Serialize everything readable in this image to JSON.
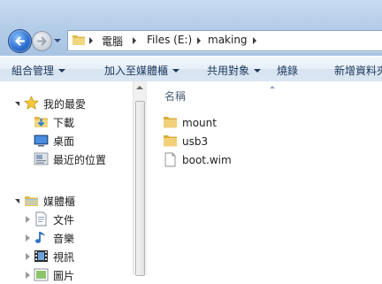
{
  "address": {
    "crumbs": [
      "電腦",
      "Files (E:)",
      "making"
    ]
  },
  "toolbar": {
    "organize": "組合管理",
    "add_to_library": "加入至媒體櫃",
    "share_with": "共用對象",
    "burn": "燒錄",
    "new_folder": "新增資料夾"
  },
  "nav": {
    "favorites": "我的最愛",
    "downloads": "下載",
    "desktop": "桌面",
    "recent_places": "最近的位置",
    "libraries": "媒體櫃",
    "documents": "文件",
    "music": "音樂",
    "videos": "視訊",
    "pictures": "圖片"
  },
  "content": {
    "column_name": "名稱",
    "files": [
      {
        "name": "mount",
        "type": "folder"
      },
      {
        "name": "usb3",
        "type": "folder"
      },
      {
        "name": "boot.wim",
        "type": "file"
      }
    ]
  },
  "colors": {
    "folder": "#e8c45a",
    "toolbar_text": "#1e395b",
    "accent_blue": "#2a6fd0"
  }
}
